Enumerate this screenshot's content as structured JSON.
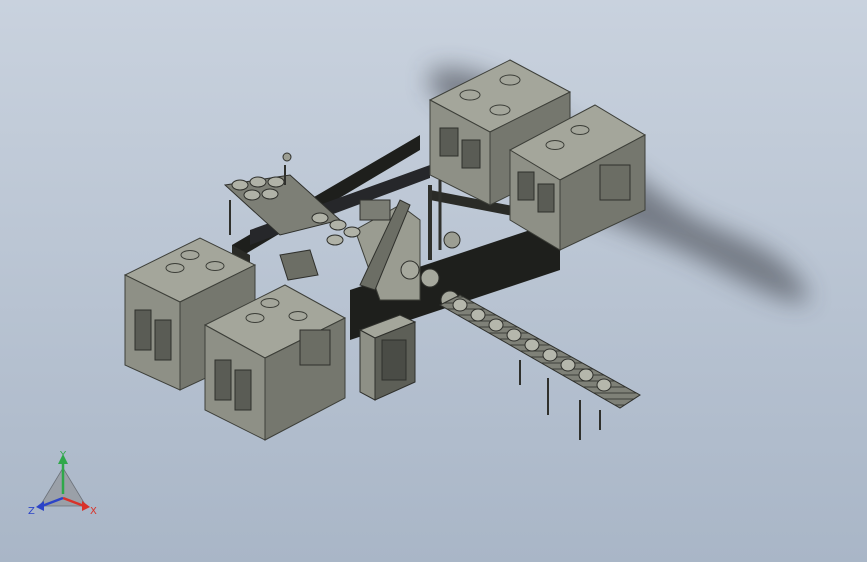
{
  "viewport": {
    "background_top": "#c9d2de",
    "background_bottom": "#a9b6c7",
    "model_fill": "#8f9187",
    "model_dark": "#4a4c46",
    "model_light": "#b6b8ad"
  },
  "triad": {
    "x_label": "X",
    "y_label": "Y",
    "z_label": "Z",
    "x_color": "#d8322a",
    "y_color": "#2fa84a",
    "z_color": "#2c44c8"
  }
}
